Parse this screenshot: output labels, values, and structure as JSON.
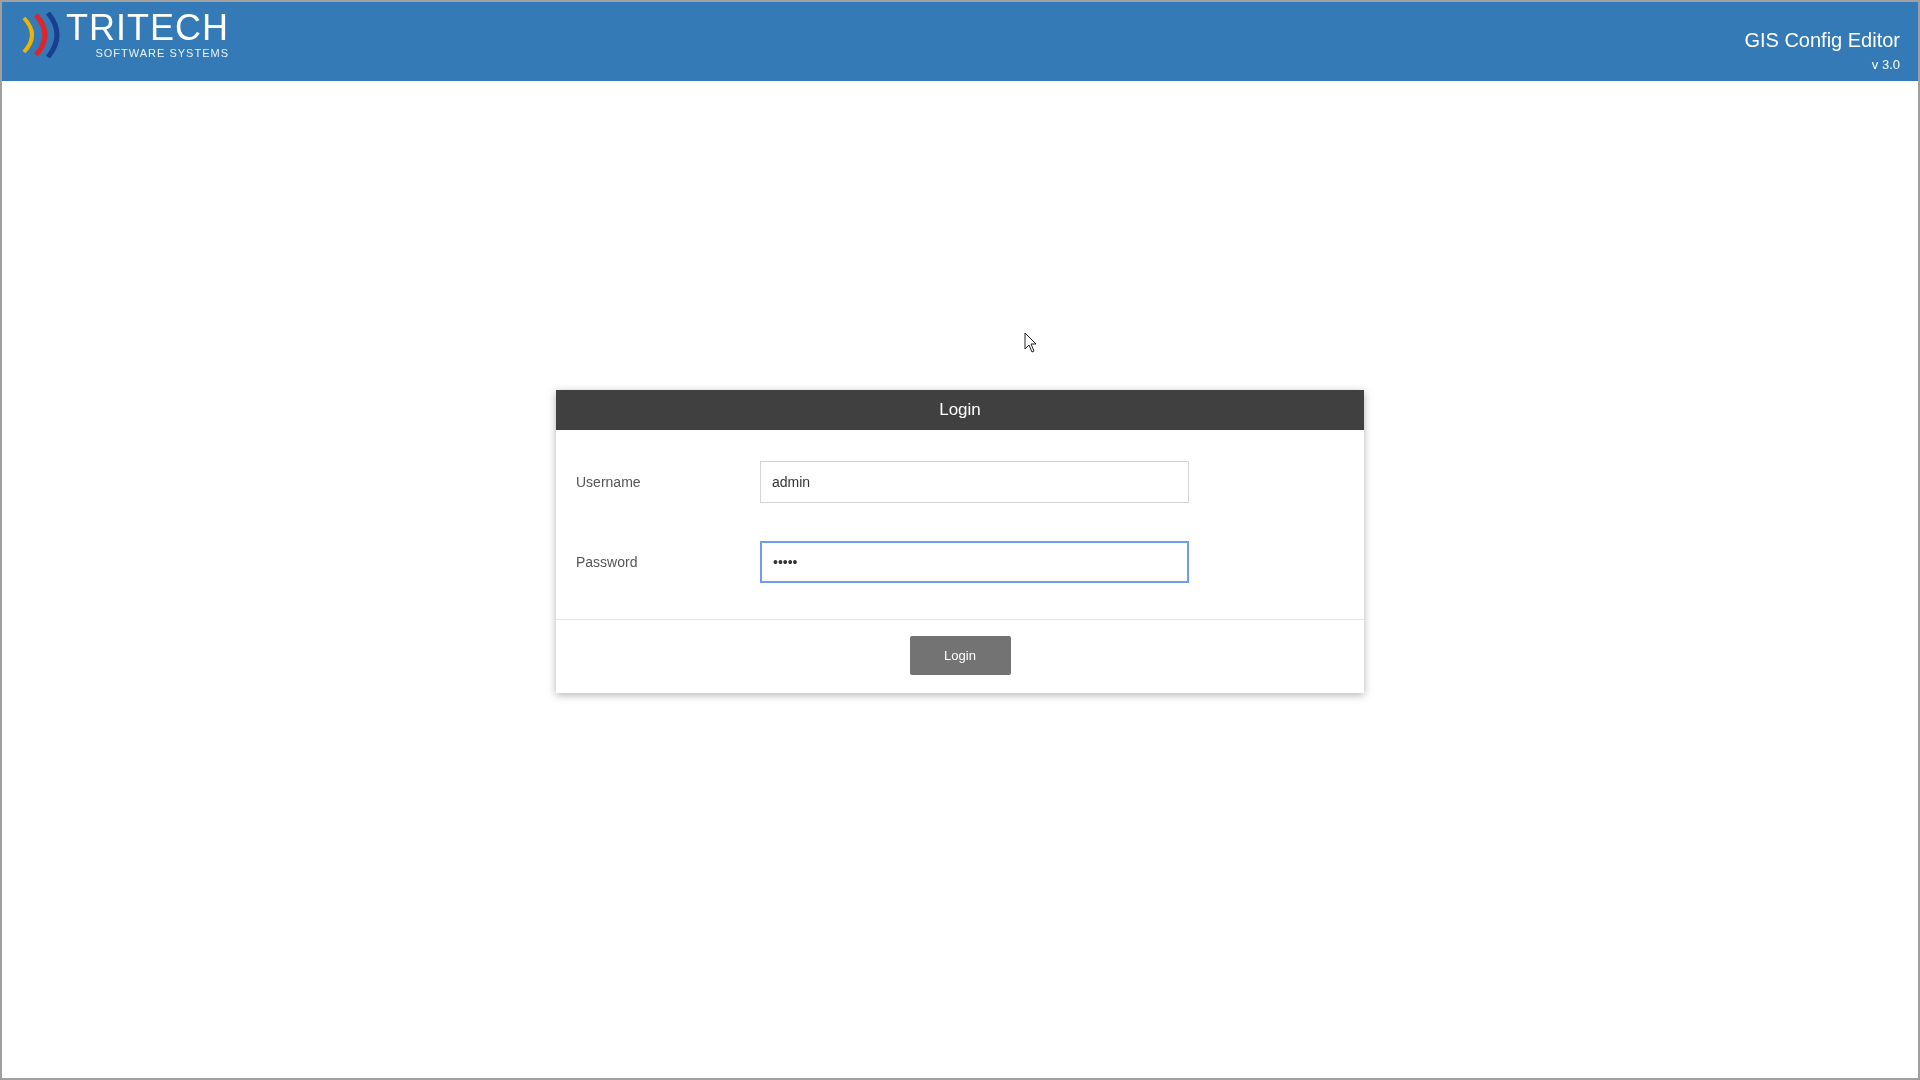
{
  "header": {
    "logo_name": "TRITECH",
    "logo_tagline": "SOFTWARE SYSTEMS",
    "app_title": "GIS Config Editor",
    "version": "v 3.0"
  },
  "login": {
    "title": "Login",
    "fields": [
      {
        "label": "Username",
        "value": "admin",
        "focused": false
      },
      {
        "label": "Password",
        "value": "•••••",
        "focused": true
      }
    ],
    "button": "Login"
  }
}
